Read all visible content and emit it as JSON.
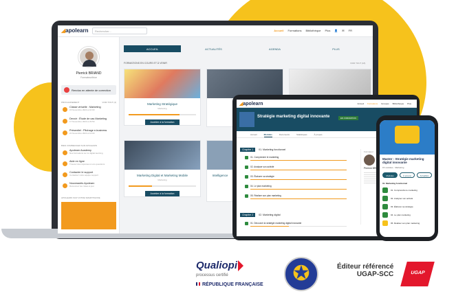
{
  "laptop": {
    "logo": "apolearn",
    "search_placeholder": "Rechercher...",
    "nav": [
      "Accueil",
      "Formations",
      "Bibliothèque",
      "Plus"
    ],
    "lang": "FR",
    "user": {
      "name": "Pierrick BRIAND",
      "role": "Formateur/trice"
    },
    "alert": "Rendus en attente de correction",
    "agenda_title": "PROCHAINEMENT",
    "agenda_link": "VOIR TOUT (4)",
    "agenda": [
      {
        "title": "Classe virtuelle : Marketing",
        "date": "15 Novembre 2024 à 10:00"
      },
      {
        "title": "Devoir : Étude de cas Marketing",
        "date": "17 Novembre 2024 à 23:59"
      },
      {
        "title": "Présentiel : Pitchage e-business",
        "date": "21 Novembre 2024 à 14:00"
      }
    ],
    "help_title": "BIEN COMMENCER SUR APOLEARN",
    "help": [
      {
        "title": "Apolearn Academy",
        "sub": "Nos formations sur le digital learning"
      },
      {
        "title": "Aide en ligne",
        "sub": "Trouvez des réponses à vos questions"
      },
      {
        "title": "Contacter le support",
        "sub": "Contactez notre équipe support"
      },
      {
        "title": "Nouveautés Apolearn",
        "sub": "Découvrez les mises à jour"
      }
    ],
    "mobile_title": "APOLEARN SUR VOTRE SMARTPHONE",
    "tabs": [
      "ACCUEIL",
      "ACTUALITÉS",
      "AGENDA",
      "PLUS"
    ],
    "courses_title": "FORMATIONS EN COURS ET À VENIR",
    "courses_link": "VOIR TOUT (18)",
    "courses": [
      {
        "title": "Marketing Stratégique",
        "cat": "Marketing",
        "progress": 0.75,
        "button": "Accéder à la formation"
      },
      {
        "title": "Marketing Digital et Marketing Mobile",
        "cat": "Marketing",
        "progress": 0.35,
        "button": "Accéder à la formation"
      }
    ],
    "partial_cards": [
      "Intelligence"
    ]
  },
  "tablet": {
    "logo": "apolearn",
    "nav": [
      "Accueil",
      "Formations",
      "Groupes",
      "Bibliothèque",
      "Plus"
    ],
    "course_title": "Stratégie marketing digital innovante",
    "badge": "EN FORMATION",
    "subtabs": [
      "Accueil",
      "Modules",
      "Documents",
      "Statistiques",
      "À propos"
    ],
    "chapters": [
      {
        "tag": "Chapitre 1",
        "title": "01. Marketing fonctionnel",
        "lessons": [
          "01. Comprendre le marketing",
          "02. Analyser son activité",
          "03. Élaborer sa stratégie",
          "04. Le plan marketing",
          "05. Réaliser son plan marketing"
        ]
      },
      {
        "tag": "Chapitre 2",
        "title": "02. Marketing digital",
        "lessons": [
          "01. Découvrir la stratégie marketing digital innovante"
        ]
      }
    ],
    "trainer_label": "Formateur",
    "trainer_name": "Pierrick BRIAND"
  },
  "phone": {
    "title": "Master - Stratégie marketing digital innovante",
    "meta": [
      "15 modules",
      "Marketing"
    ],
    "buttons": [
      "Modules",
      "À propos",
      "Actualités"
    ],
    "section": "01. Marketing fonctionnel",
    "lessons": [
      "01. Comprendre le marketing",
      "02. Analyser son activité",
      "03. Élaborer sa stratégie",
      "04. Le plan marketing",
      "05. Réaliser son plan marketing"
    ]
  },
  "footer": {
    "qualiopi": "Qualiopi",
    "qualiopi_sub": "processus certifié",
    "republique": "RÉPUBLIQUE FRANÇAISE",
    "editor": "Éditeur référencé",
    "ugap": "UGAP-SCC",
    "ugap_logo": "UGAP"
  },
  "colors": {
    "accent": "#f29a1e",
    "primary": "#184c63",
    "yellow": "#f6c21c",
    "eu_blue": "#233c96",
    "ugap_red": "#e3172c"
  }
}
